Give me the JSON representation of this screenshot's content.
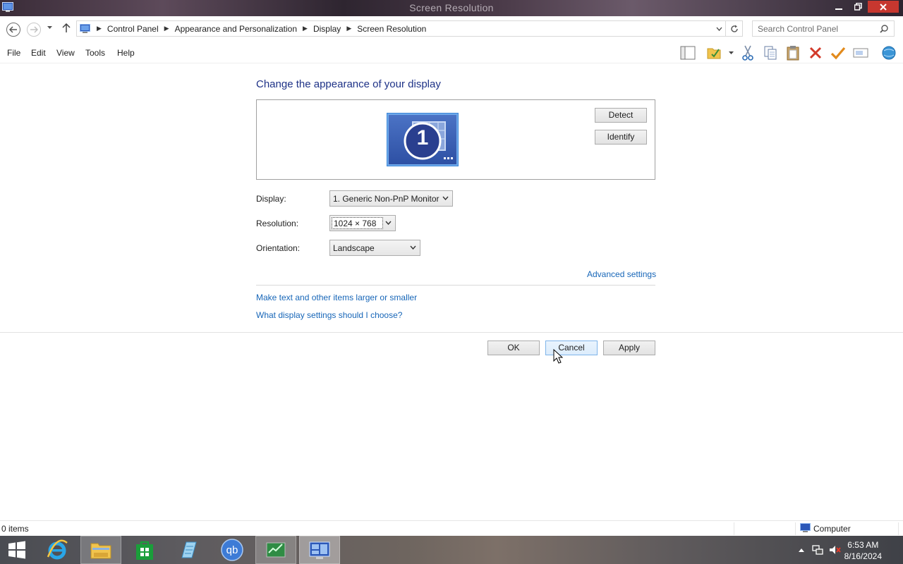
{
  "window": {
    "title": "Screen Resolution"
  },
  "address": {
    "crumbs": [
      "Control Panel",
      "Appearance and Personalization",
      "Display",
      "Screen Resolution"
    ],
    "search_placeholder": "Search Control Panel"
  },
  "menu": {
    "items": [
      "File",
      "Edit",
      "View",
      "Tools",
      "Help"
    ]
  },
  "page": {
    "heading": "Change the appearance of your display",
    "monitor_number": "1",
    "detect_label": "Detect",
    "identify_label": "Identify",
    "display_label": "Display:",
    "display_value": "1. Generic Non-PnP Monitor",
    "resolution_label": "Resolution:",
    "resolution_value": "1024 × 768",
    "orientation_label": "Orientation:",
    "orientation_value": "Landscape",
    "advanced_link": "Advanced settings",
    "text_size_link": "Make text and other items larger or smaller",
    "help_link": "What display settings should I choose?",
    "ok_label": "OK",
    "cancel_label": "Cancel",
    "apply_label": "Apply"
  },
  "status": {
    "items": "0 items",
    "location": "Computer"
  },
  "taskbar": {
    "time": "6:53 AM",
    "date": "8/16/2024",
    "apps": [
      "start",
      "internet-explorer",
      "file-explorer",
      "store",
      "notepad",
      "qbittorrent",
      "task-manager",
      "control-panel-display"
    ]
  },
  "colors": {
    "link": "#1766b8",
    "heading": "#1e3287",
    "close_button": "#c7372f"
  }
}
